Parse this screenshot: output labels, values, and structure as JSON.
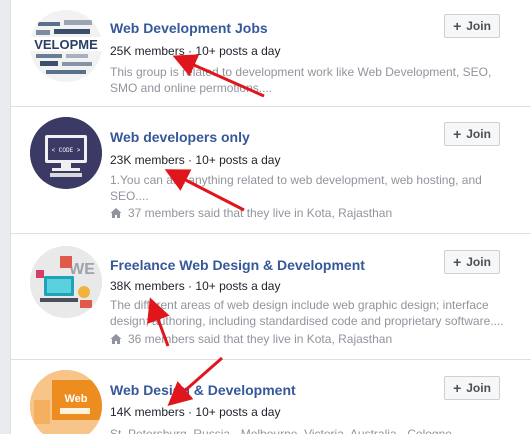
{
  "groups": [
    {
      "title": "Web Development Jobs",
      "members": "25K members",
      "posts": "10+ posts a day",
      "description": "This group is related to development work like Web Development, SEO, SMO and online permotions....",
      "location": "",
      "join_label": "Join",
      "thumb_icon": "web-development-word-cloud",
      "thumb_text": "VELOPME"
    },
    {
      "title": "Web developers only",
      "members": "23K members",
      "posts": "10+ posts a day",
      "description": "1.You can ask anything related to web development, web hosting, and SEO....",
      "location": "37 members said that they live in Kota, Rajasthan",
      "join_label": "Join",
      "thumb_icon": "monitor-code-icon",
      "thumb_text": "< CODE >"
    },
    {
      "title": "Freelance Web Design & Development",
      "members": "38K members",
      "posts": "10+ posts a day",
      "description": "The different areas of web design include web graphic design; interface design; authoring, including standardised code and proprietary software....",
      "location": "36 members said that they live in Kota, Rajasthan",
      "join_label": "Join",
      "thumb_icon": "web-design-illustration",
      "thumb_text": "WE"
    },
    {
      "title": "Web Design & Development",
      "members": "14K members",
      "posts": "10+ posts a day",
      "description": "St. Petersburg, Russia · Melbourne, Victoria, Australia · Cologne",
      "location": "",
      "join_label": "Join",
      "thumb_icon": "web-design-orange-graphic",
      "thumb_text": "Web"
    }
  ],
  "separator": "·",
  "colors": {
    "title": "#365899",
    "arrow": "#e0161c",
    "muted": "#90949c"
  }
}
